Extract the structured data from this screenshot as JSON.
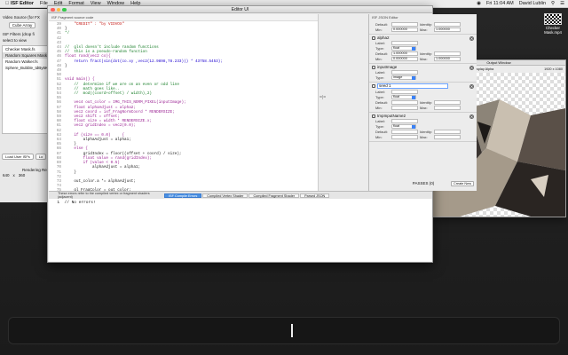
{
  "menubar": {
    "app_name": "ISF Editor",
    "items": [
      "File",
      "Edit",
      "Format",
      "View",
      "Window",
      "Help"
    ],
    "status_time": "Fri 11:04 AM",
    "user": "David Lublin"
  },
  "bg_window": {
    "video_source_label": "Video Source (for FX",
    "cube_button": "Cube Array",
    "filters_label_1": "ISF Filters (drop fi",
    "filters_label_2": "select to view",
    "items": [
      "Checker Mask.fs",
      "Random Squares Mask.fs",
      "Random Walker.fs",
      "Sphere_Bubble_tdBy6K.fs"
    ],
    "load_button": "Load User ISFs",
    "lo_button": "Lo",
    "rendering_label": "Rendering Re",
    "width": "640",
    "x_label": "x",
    "height": "360"
  },
  "editor": {
    "title": "Editor UI",
    "code_header": "ISF Fragment source code",
    "code_lines": [
      {
        "n": "39",
        "t": "    \"CREDIT\" : \"by VIDVOX\"",
        "c": "c-str"
      },
      {
        "n": "40",
        "t": "}",
        "c": ""
      },
      {
        "n": "41",
        "t": "*/",
        "c": "c-com"
      },
      {
        "n": "42",
        "t": "",
        "c": ""
      },
      {
        "n": "43",
        "t": "",
        "c": ""
      },
      {
        "n": "44",
        "t": "//  glsl doesn't include random functions",
        "c": "c-com"
      },
      {
        "n": "45",
        "t": "//  this is a pseudo-random function",
        "c": "c-com"
      },
      {
        "n": "46",
        "t": "float rand(vec2 co){",
        "c": "c-kw"
      },
      {
        "n": "47",
        "t": "    return fract(sin(dot(co.xy ,vec2(12.9898,78.233))) * 43758.5453);",
        "c": "c-num"
      },
      {
        "n": "48",
        "t": "}",
        "c": ""
      },
      {
        "n": "49",
        "t": "",
        "c": ""
      },
      {
        "n": "50",
        "t": "",
        "c": ""
      },
      {
        "n": "51",
        "t": "void main() {",
        "c": "c-kw"
      },
      {
        "n": "52",
        "t": "    //  determine if we are on an even or odd line",
        "c": "c-com"
      },
      {
        "n": "53",
        "t": "    //  math goes like..",
        "c": "c-com"
      },
      {
        "n": "54",
        "t": "    //  mod((coord+offset) / width),2)",
        "c": "c-com"
      },
      {
        "n": "55",
        "t": "",
        "c": ""
      },
      {
        "n": "56",
        "t": "    vec4 out_color = IMG_THIS_NORM_PIXEL(inputImage);",
        "c": "c-kw"
      },
      {
        "n": "57",
        "t": "    float alphaAdjust = alpha2;",
        "c": "c-kw"
      },
      {
        "n": "58",
        "t": "    vec2 coord = isf_FragNormCoord * RENDERSIZE;",
        "c": "c-kw"
      },
      {
        "n": "59",
        "t": "    vec2 shift = offset;",
        "c": "c-kw"
      },
      {
        "n": "60",
        "t": "    float size = width * RENDERSIZE.x;",
        "c": "c-kw"
      },
      {
        "n": "61",
        "t": "    vec2 gridIndex = vec2(0.0);",
        "c": "c-kw"
      },
      {
        "n": "62",
        "t": "",
        "c": ""
      },
      {
        "n": "63",
        "t": "    if (size == 0.0)     {",
        "c": "c-kw"
      },
      {
        "n": "64",
        "t": "        alphaAdjust = alpha1;",
        "c": ""
      },
      {
        "n": "65",
        "t": "    }",
        "c": ""
      },
      {
        "n": "66",
        "t": "    else {",
        "c": "c-kw"
      },
      {
        "n": "67",
        "t": "        gridIndex = floor((offset + coord) / size);",
        "c": ""
      },
      {
        "n": "68",
        "t": "        float value = rand(gridIndex);",
        "c": "c-kw"
      },
      {
        "n": "69",
        "t": "        if (value < 0.5)",
        "c": "c-kw"
      },
      {
        "n": "70",
        "t": "            alphaAdjust = alpha1;",
        "c": ""
      },
      {
        "n": "71",
        "t": "    }",
        "c": ""
      },
      {
        "n": "72",
        "t": "",
        "c": ""
      },
      {
        "n": "73",
        "t": "    out_color.a *= alphaAdjust;",
        "c": ""
      },
      {
        "n": "74",
        "t": "",
        "c": ""
      },
      {
        "n": "75",
        "t": "    gl_FragColor = out_color;",
        "c": ""
      },
      {
        "n": "76",
        "t": "}",
        "c": ""
      }
    ],
    "divider_glyph": "=|=",
    "json_header": "ISF JSON Editor",
    "top_fields": {
      "default_label": "Default:",
      "default_val": "",
      "identity_label": "Identity:",
      "identity_val": "",
      "min_label": "Min:",
      "min_val": "0.000000",
      "max_label": "Max:",
      "max_val": "1.000000"
    },
    "inputs": [
      {
        "name": "alpha2",
        "label_label": "Label:",
        "label_val": "",
        "type_label": "Type:",
        "type_val": "float",
        "default_label": "Default:",
        "default_val": "1.000000",
        "identity_label": "Identity:",
        "identity_val": "",
        "min_label": "Min:",
        "min_val": "0.000000",
        "max_label": "Max:",
        "max_val": "1.000000"
      },
      {
        "name": "inputImage",
        "label_label": "Label:",
        "label_val": "",
        "type_label": "Type:",
        "type_val": "image"
      },
      {
        "name": "seed 1",
        "label_label": "Label:",
        "label_val": "",
        "type_label": "Type:",
        "type_val": "float",
        "default_label": "Default:",
        "default_val": "",
        "identity_label": "Identity:",
        "identity_val": "",
        "min_label": "Min:",
        "min_val": "",
        "max_label": "Max:",
        "max_val": ""
      },
      {
        "name": "tmpInputName2",
        "label_label": "Label:",
        "label_val": "",
        "type_label": "Type:",
        "type_val": "float",
        "default_label": "Default:",
        "default_val": "",
        "identity_label": "Identity:",
        "identity_val": "",
        "min_label": "Min:",
        "min_val": "",
        "max_label": "Max:",
        "max_val": ""
      }
    ],
    "passes_label": "PASSES (0)",
    "create_new_button": "Create New",
    "error_message": "These errors refer to the compiled vertex or fragment shaders (adjacent)",
    "error_tabs": [
      "ISF Compile Errors",
      "Compiled Vertex Shader",
      "Compiled Fragment Shader",
      "Parsed JSON"
    ],
    "error_text": "  1  // No errors!"
  },
  "output_window": {
    "title": "Output Window",
    "freeze_label": "Freeze Output",
    "display_alpha_label": "Display Alpha",
    "resolution": "1920 x 1080"
  },
  "desktop_file": {
    "name_line1": "Checker",
    "name_line2": "Mask.mp4"
  },
  "colors": {
    "active_tab": "#4a90e2",
    "selected_field_border": "#6aa2ff"
  }
}
